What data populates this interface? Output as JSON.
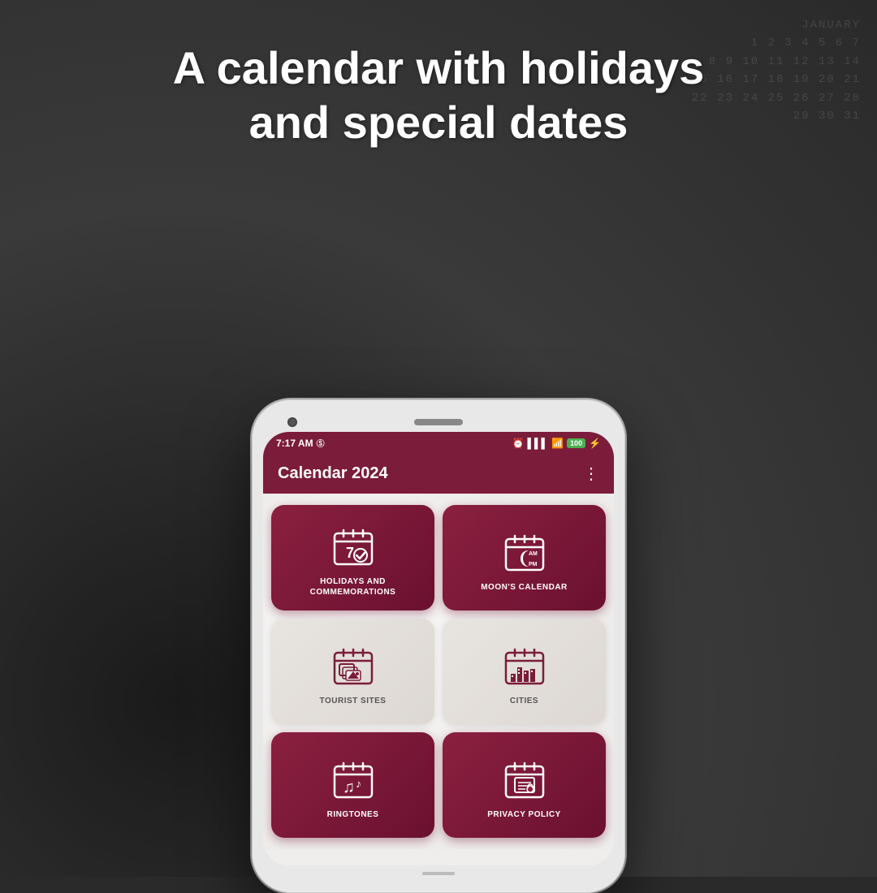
{
  "header": {
    "title_line1": "A calendar with holidays",
    "title_line2": "and special dates"
  },
  "status_bar": {
    "time": "7:17 AM",
    "sim_icon": "S",
    "alarm_icon": "⏰",
    "signal_icon": "📶",
    "wifi_icon": "WiFi",
    "battery_label": "100",
    "bolt_icon": "⚡"
  },
  "app_bar": {
    "title": "Calendar 2024",
    "menu_icon": "⋮"
  },
  "grid": {
    "cards": [
      {
        "id": "holidays",
        "label": "HOLIDAYS AND\nCOMMEMORATIONS",
        "style": "dark",
        "icon_type": "calendar-check"
      },
      {
        "id": "moons-calendar",
        "label": "MOON'S CALENDAR",
        "style": "dark",
        "icon_type": "calendar-moon"
      },
      {
        "id": "tourist-sites",
        "label": "TOURIST SITES",
        "style": "light",
        "icon_type": "calendar-photos"
      },
      {
        "id": "cities",
        "label": "CITIES",
        "style": "light",
        "icon_type": "calendar-city"
      },
      {
        "id": "ringtones",
        "label": "RINGTONES",
        "style": "dark",
        "icon_type": "calendar-music"
      },
      {
        "id": "privacy-policy",
        "label": "PRIVACY POLICY",
        "style": "dark",
        "icon_type": "calendar-doc"
      }
    ]
  },
  "colors": {
    "accent": "#7b1c3a",
    "card_dark": "#8b2040",
    "card_light": "#e8e4e0"
  }
}
